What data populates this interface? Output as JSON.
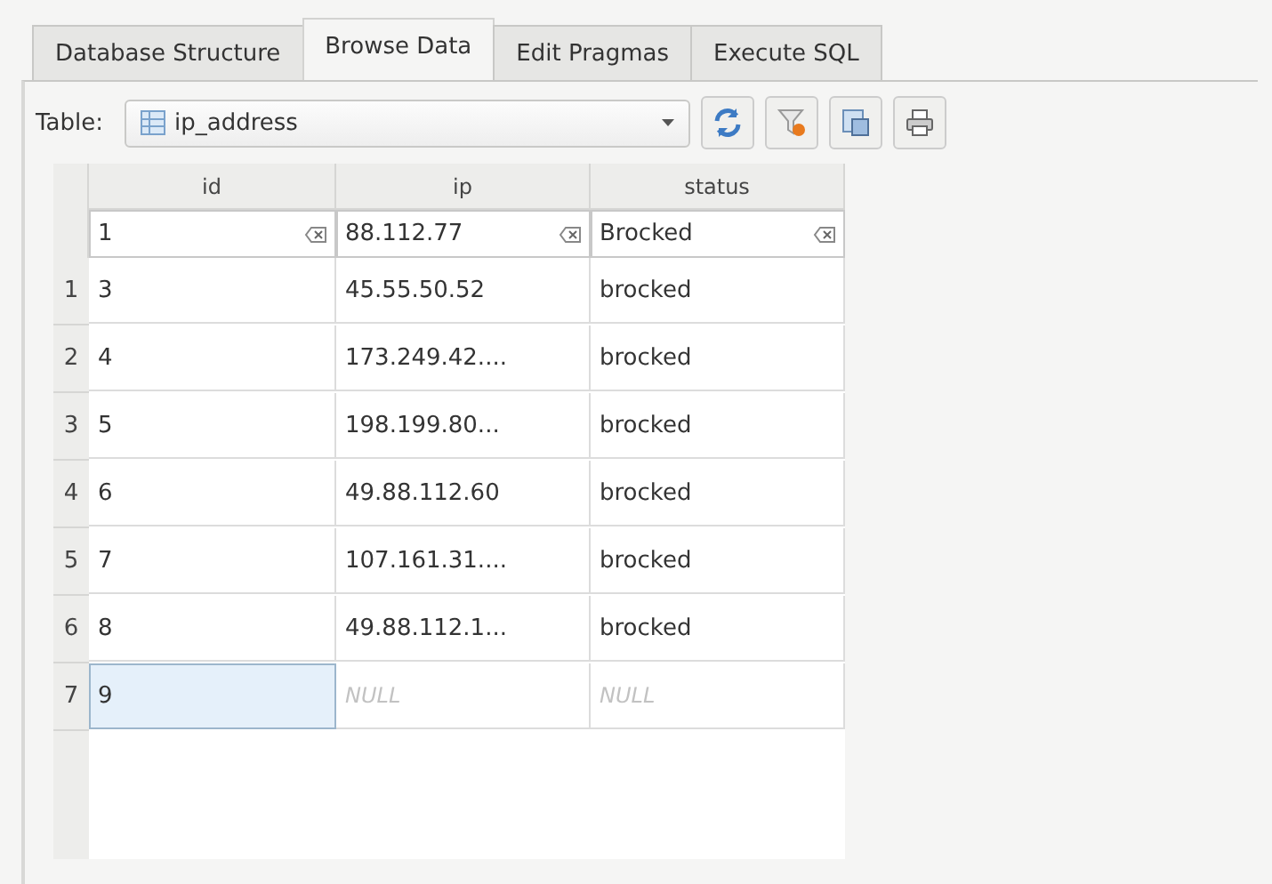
{
  "tabs": [
    {
      "label": "Database Structure",
      "selected": false
    },
    {
      "label": "Browse Data",
      "selected": true
    },
    {
      "label": "Edit Pragmas",
      "selected": false
    },
    {
      "label": "Execute SQL",
      "selected": false
    }
  ],
  "table_selector": {
    "label": "Table:",
    "value": "ip_address"
  },
  "grid": {
    "columns": [
      "id",
      "ip",
      "status"
    ],
    "filters": [
      "1",
      "88.112.77",
      "Brocked"
    ],
    "rows": [
      {
        "number": "1",
        "cells": [
          {
            "text": "3",
            "kind": "value",
            "selected": false
          },
          {
            "text": "45.55.50.52",
            "kind": "value",
            "selected": false
          },
          {
            "text": "brocked",
            "kind": "value",
            "selected": false
          }
        ]
      },
      {
        "number": "2",
        "cells": [
          {
            "text": "4",
            "kind": "value",
            "selected": false
          },
          {
            "text": "173.249.42....",
            "kind": "value",
            "selected": false
          },
          {
            "text": "brocked",
            "kind": "value",
            "selected": false
          }
        ]
      },
      {
        "number": "3",
        "cells": [
          {
            "text": "5",
            "kind": "value",
            "selected": false
          },
          {
            "text": "198.199.80...",
            "kind": "value",
            "selected": false
          },
          {
            "text": "brocked",
            "kind": "value",
            "selected": false
          }
        ]
      },
      {
        "number": "4",
        "cells": [
          {
            "text": "6",
            "kind": "value",
            "selected": false
          },
          {
            "text": "49.88.112.60",
            "kind": "value",
            "selected": false
          },
          {
            "text": "brocked",
            "kind": "value",
            "selected": false
          }
        ]
      },
      {
        "number": "5",
        "cells": [
          {
            "text": "7",
            "kind": "value",
            "selected": false
          },
          {
            "text": "107.161.31....",
            "kind": "value",
            "selected": false
          },
          {
            "text": "brocked",
            "kind": "value",
            "selected": false
          }
        ]
      },
      {
        "number": "6",
        "cells": [
          {
            "text": "8",
            "kind": "value",
            "selected": false
          },
          {
            "text": "49.88.112.1...",
            "kind": "value",
            "selected": false
          },
          {
            "text": "brocked",
            "kind": "value",
            "selected": false
          }
        ]
      },
      {
        "number": "7",
        "cells": [
          {
            "text": "9",
            "kind": "value",
            "selected": true
          },
          {
            "text": "NULL",
            "kind": "null",
            "selected": false
          },
          {
            "text": "NULL",
            "kind": "null",
            "selected": false
          }
        ]
      }
    ]
  }
}
